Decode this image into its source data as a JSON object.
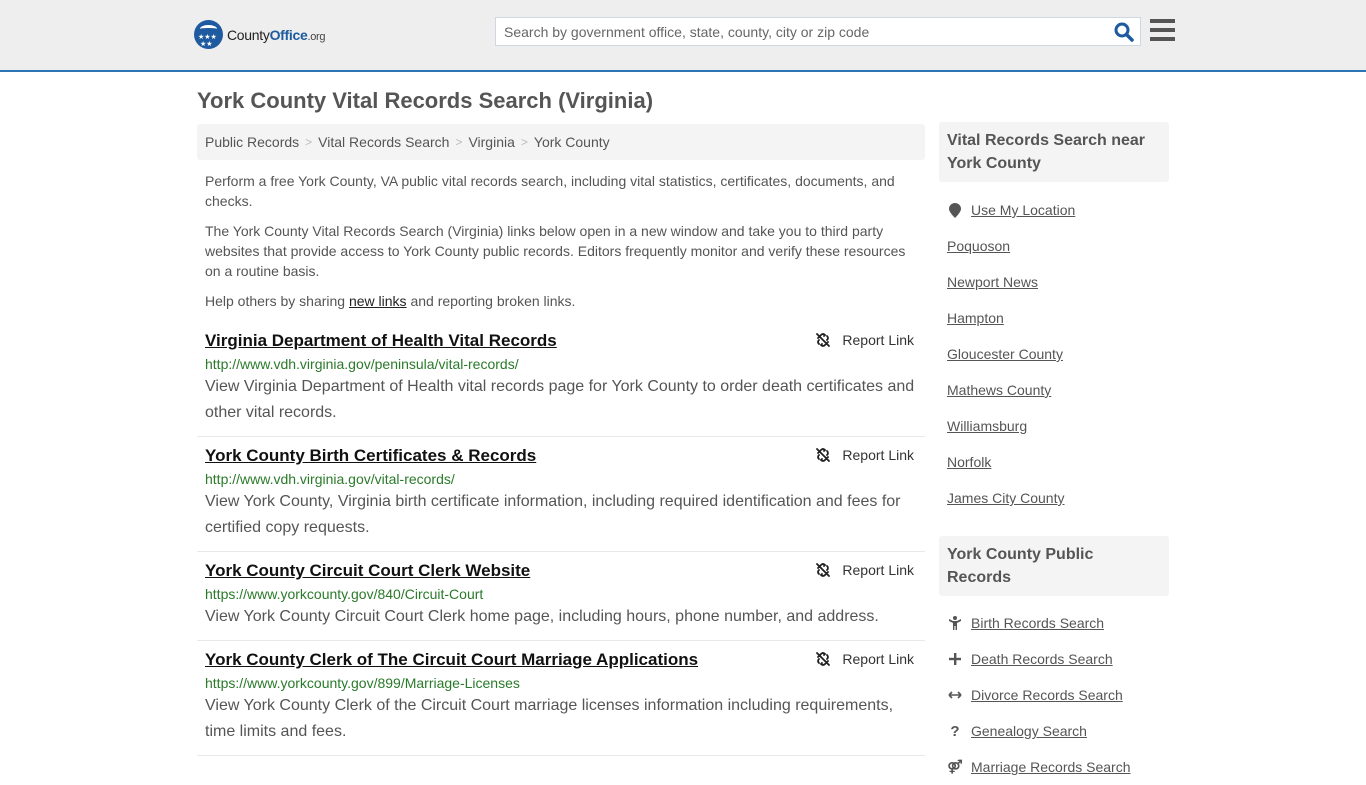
{
  "header": {
    "logo_text_main": "County",
    "logo_text_accent": "Office",
    "logo_text_tld": ".org",
    "search_placeholder": "Search by government office, state, county, city or zip code",
    "search_value": ""
  },
  "page_title": "York County Vital Records Search (Virginia)",
  "breadcrumb": [
    {
      "label": "Public Records"
    },
    {
      "label": "Vital Records Search"
    },
    {
      "label": "Virginia"
    },
    {
      "label": "York County"
    }
  ],
  "breadcrumb_separator": ">",
  "intro": {
    "p1": "Perform a free York County, VA public vital records search, including vital statistics, certificates, documents, and checks.",
    "p2": "The York County Vital Records Search (Virginia) links below open in a new window and take you to third party websites that provide access to York County public records. Editors frequently monitor and verify these resources on a routine basis.",
    "p3_before": "Help others by sharing ",
    "p3_link": "new links",
    "p3_after": " and reporting broken links."
  },
  "report_label": "Report Link",
  "results": [
    {
      "title": "Virginia Department of Health Vital Records",
      "url": "http://www.vdh.virginia.gov/peninsula/vital-records/",
      "description": "View Virginia Department of Health vital records page for York County to order death certificates and other vital records."
    },
    {
      "title": "York County Birth Certificates & Records",
      "url": "http://www.vdh.virginia.gov/vital-records/",
      "description": "View York County, Virginia birth certificate information, including required identification and fees for certified copy requests."
    },
    {
      "title": "York County Circuit Court Clerk Website",
      "url": "https://www.yorkcounty.gov/840/Circuit-Court",
      "description": "View York County Circuit Court Clerk home page, including hours, phone number, and address."
    },
    {
      "title": "York County Clerk of The Circuit Court Marriage Applications",
      "url": "https://www.yorkcounty.gov/899/Marriage-Licenses",
      "description": "View York County Clerk of the Circuit Court marriage licenses information including requirements, time limits and fees."
    }
  ],
  "sidebar": {
    "nearby": {
      "heading": "Vital Records Search near York County",
      "use_location": "Use My Location",
      "items": [
        "Poquoson",
        "Newport News",
        "Hampton",
        "Gloucester County",
        "Mathews County",
        "Williamsburg",
        "Norfolk",
        "James City County"
      ]
    },
    "public_records": {
      "heading": "York County Public Records",
      "items": [
        {
          "label": "Birth Records Search",
          "icon": "child-icon"
        },
        {
          "label": "Death Records Search",
          "icon": "plus-icon"
        },
        {
          "label": "Divorce Records Search",
          "icon": "arrows-horizontal-icon"
        },
        {
          "label": "Genealogy Search",
          "icon": "question-icon"
        },
        {
          "label": "Marriage Records Search",
          "icon": "marriage-icon"
        }
      ]
    }
  },
  "colors": {
    "accent": "#2c74b3",
    "logo_blue": "#1e5aa0",
    "url_green": "#2a7a2a",
    "header_bg": "#eeeeee",
    "panel_bg": "#f4f4f4"
  }
}
